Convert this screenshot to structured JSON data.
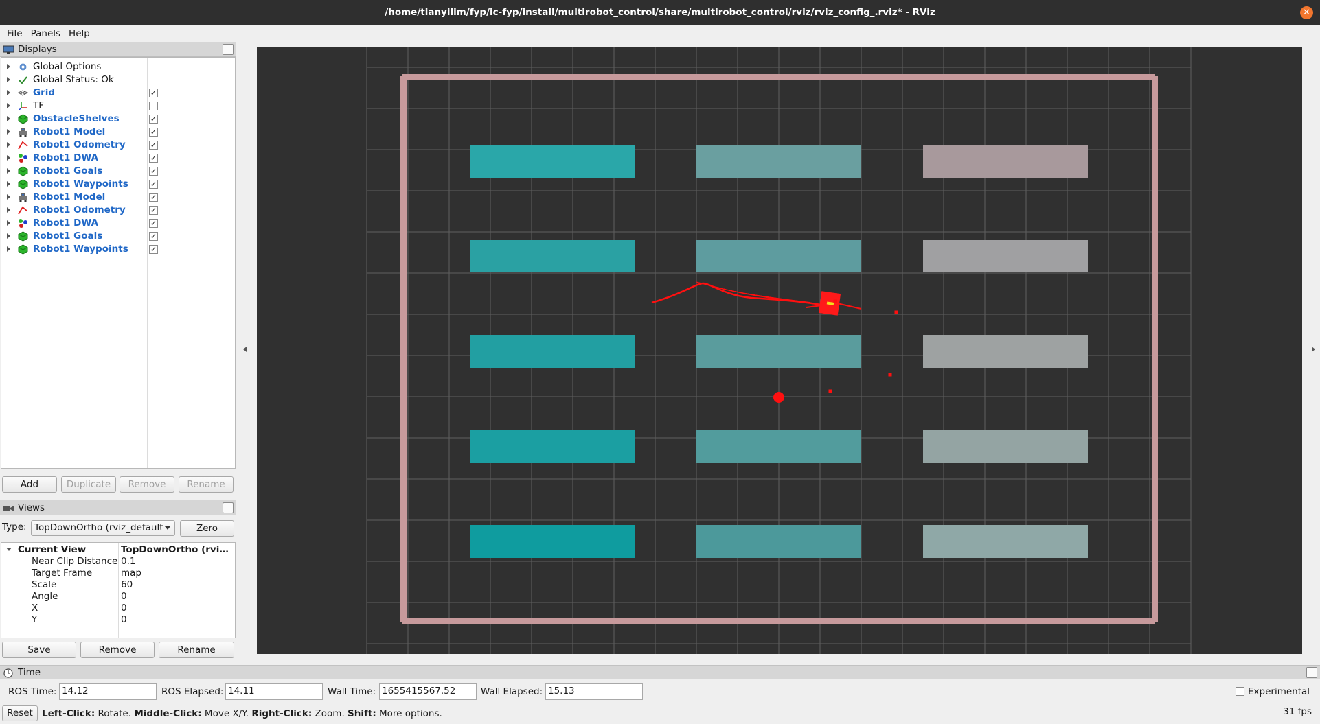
{
  "window": {
    "title": "/home/tianyilim/fyp/ic-fyp/install/multirobot_control/share/multirobot_control/rviz/rviz_config_.rviz* - RViz"
  },
  "menu": [
    "File",
    "Panels",
    "Help"
  ],
  "displays": {
    "title": "Displays",
    "items": [
      {
        "label": "Global Options",
        "icon": "gear-icon",
        "enabled": null,
        "highlight": false
      },
      {
        "label": "Global Status: Ok",
        "icon": "checkmark-icon",
        "enabled": null,
        "highlight": false
      },
      {
        "label": "Grid",
        "icon": "grid-icon",
        "enabled": true,
        "highlight": true
      },
      {
        "label": "TF",
        "icon": "tf-axes-icon",
        "enabled": false,
        "highlight": false
      },
      {
        "label": "ObstacleShelves",
        "icon": "marker-cube-icon",
        "enabled": true,
        "highlight": true
      },
      {
        "label": "Robot1 Model",
        "icon": "robot-model-icon",
        "enabled": true,
        "highlight": true
      },
      {
        "label": "Robot1 Odometry",
        "icon": "odometry-icon",
        "enabled": true,
        "highlight": true
      },
      {
        "label": "Robot1 DWA",
        "icon": "marker-array-icon",
        "enabled": true,
        "highlight": true
      },
      {
        "label": "Robot1 Goals",
        "icon": "marker-cube-icon",
        "enabled": true,
        "highlight": true
      },
      {
        "label": "Robot1 Waypoints",
        "icon": "marker-cube-icon",
        "enabled": true,
        "highlight": true
      },
      {
        "label": "Robot1 Model",
        "icon": "robot-model-icon",
        "enabled": true,
        "highlight": true
      },
      {
        "label": "Robot1 Odometry",
        "icon": "odometry-icon",
        "enabled": true,
        "highlight": true
      },
      {
        "label": "Robot1 DWA",
        "icon": "marker-array-icon",
        "enabled": true,
        "highlight": true
      },
      {
        "label": "Robot1 Goals",
        "icon": "marker-cube-icon",
        "enabled": true,
        "highlight": true
      },
      {
        "label": "Robot1 Waypoints",
        "icon": "marker-cube-icon",
        "enabled": true,
        "highlight": true
      }
    ],
    "buttons": {
      "add": "Add",
      "duplicate": "Duplicate",
      "remove": "Remove",
      "rename": "Rename"
    }
  },
  "views": {
    "title": "Views",
    "type_label": "Type:",
    "type_value": "TopDownOrtho (rviz_default",
    "zero_label": "Zero",
    "current": {
      "label": "Current View",
      "value": "TopDownOrtho (rviz..."
    },
    "properties": [
      {
        "key": "Near Clip Distance",
        "value": "0.1"
      },
      {
        "key": "Target Frame",
        "value": "map"
      },
      {
        "key": "Scale",
        "value": "60"
      },
      {
        "key": "Angle",
        "value": "0"
      },
      {
        "key": "X",
        "value": "0"
      },
      {
        "key": "Y",
        "value": "0"
      }
    ],
    "buttons": {
      "save": "Save",
      "remove": "Remove",
      "rename": "Rename"
    }
  },
  "time": {
    "title": "Time",
    "ros_time_label": "ROS Time:",
    "ros_time": "14.12",
    "ros_elapsed_label": "ROS Elapsed:",
    "ros_elapsed": "14.11",
    "wall_time_label": "Wall Time:",
    "wall_time": "1655415567.52",
    "wall_elapsed_label": "Wall Elapsed:",
    "wall_elapsed": "15.13",
    "experimental_label": "Experimental"
  },
  "status": {
    "reset_label": "Reset",
    "hint": [
      {
        "bold": "Left-Click:",
        "text": " Rotate. "
      },
      {
        "bold": "Middle-Click:",
        "text": " Move X/Y. "
      },
      {
        "bold": "Right-Click:",
        "text": " Zoom. "
      },
      {
        "bold": "Shift:",
        "text": " More options."
      }
    ],
    "fps": "31 fps"
  },
  "scene": {
    "background": "#303030",
    "grid_color": "#5f5f5f",
    "wall_color": "#c79a9c",
    "shelf_colors": [
      "#229fa3",
      "#5a9c9e",
      "#99999d"
    ],
    "trajectory_color": "#ff1010"
  }
}
